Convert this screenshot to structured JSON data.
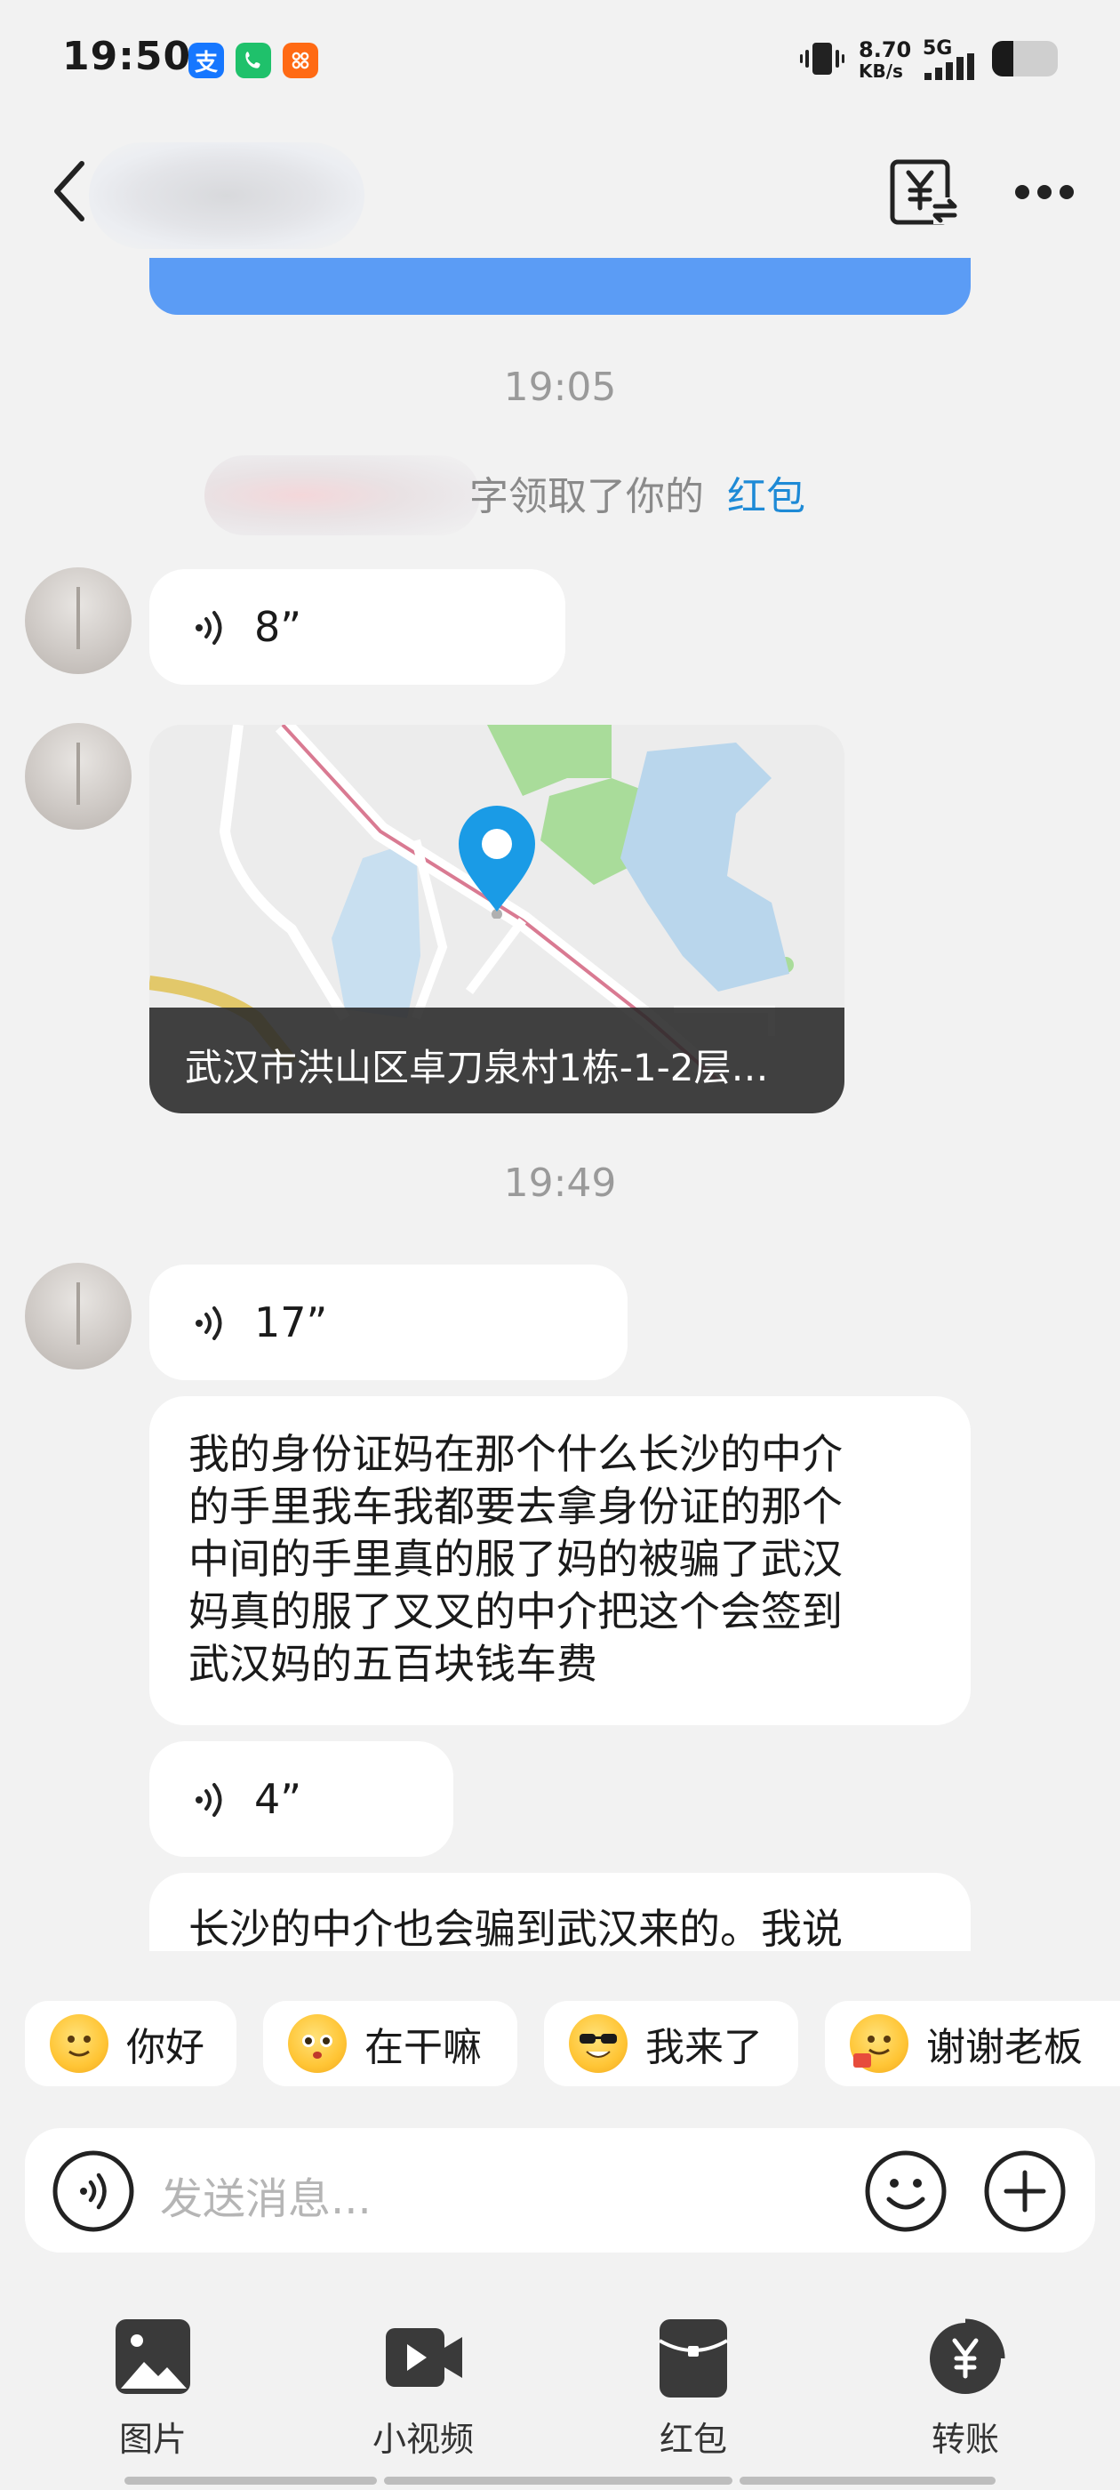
{
  "status_bar": {
    "time": "19:50",
    "speed_value": "8.70",
    "speed_unit": "KB/s",
    "network": "5G",
    "app_icons": [
      "alipay-icon",
      "phone-app-icon",
      "taobao-icon"
    ]
  },
  "header": {
    "back_icon": "chevron-left-icon",
    "transfer_icon": "yuan-transfer-icon",
    "more_icon": "more-dots-icon"
  },
  "messages": {
    "time_1": "19:05",
    "system_notice_fragment": "字领取了你的",
    "system_notice_link": "红包",
    "voice_1_duration": "8”",
    "location_address": "武汉市洪山区卓刀泉村1栋-1-2层…",
    "time_2": "19:49",
    "voice_2_duration": "17”",
    "text_1_lines": [
      "我的身份证妈在那个什么长沙的中介",
      "的手里我车我都要去拿身份证的那个",
      "中间的手里真的服了妈的被骗了武汉",
      "妈真的服了叉叉的中介把这个会签到",
      "武汉妈的五百块钱车费"
    ],
    "voice_3_duration": "4”",
    "text_2_partial": "长沙的中介也会骗到武汉来的。我说"
  },
  "quick_replies": [
    {
      "label": "你好",
      "icon": "wave-emoji-icon"
    },
    {
      "label": "在干嘛",
      "icon": "curious-emoji-icon"
    },
    {
      "label": "我来了",
      "icon": "sunglasses-emoji-icon"
    },
    {
      "label": "谢谢老板",
      "icon": "thanks-emoji-icon"
    }
  ],
  "input": {
    "placeholder": "发送消息..."
  },
  "toolbar": {
    "photo_label": "图片",
    "video_label": "小视频",
    "redpacket_label": "红包",
    "transfer_label": "转账"
  },
  "colors": {
    "link_blue": "#1e8ad6",
    "pin_blue": "#1a9be6",
    "banner_blue": "#5b9cf5"
  }
}
